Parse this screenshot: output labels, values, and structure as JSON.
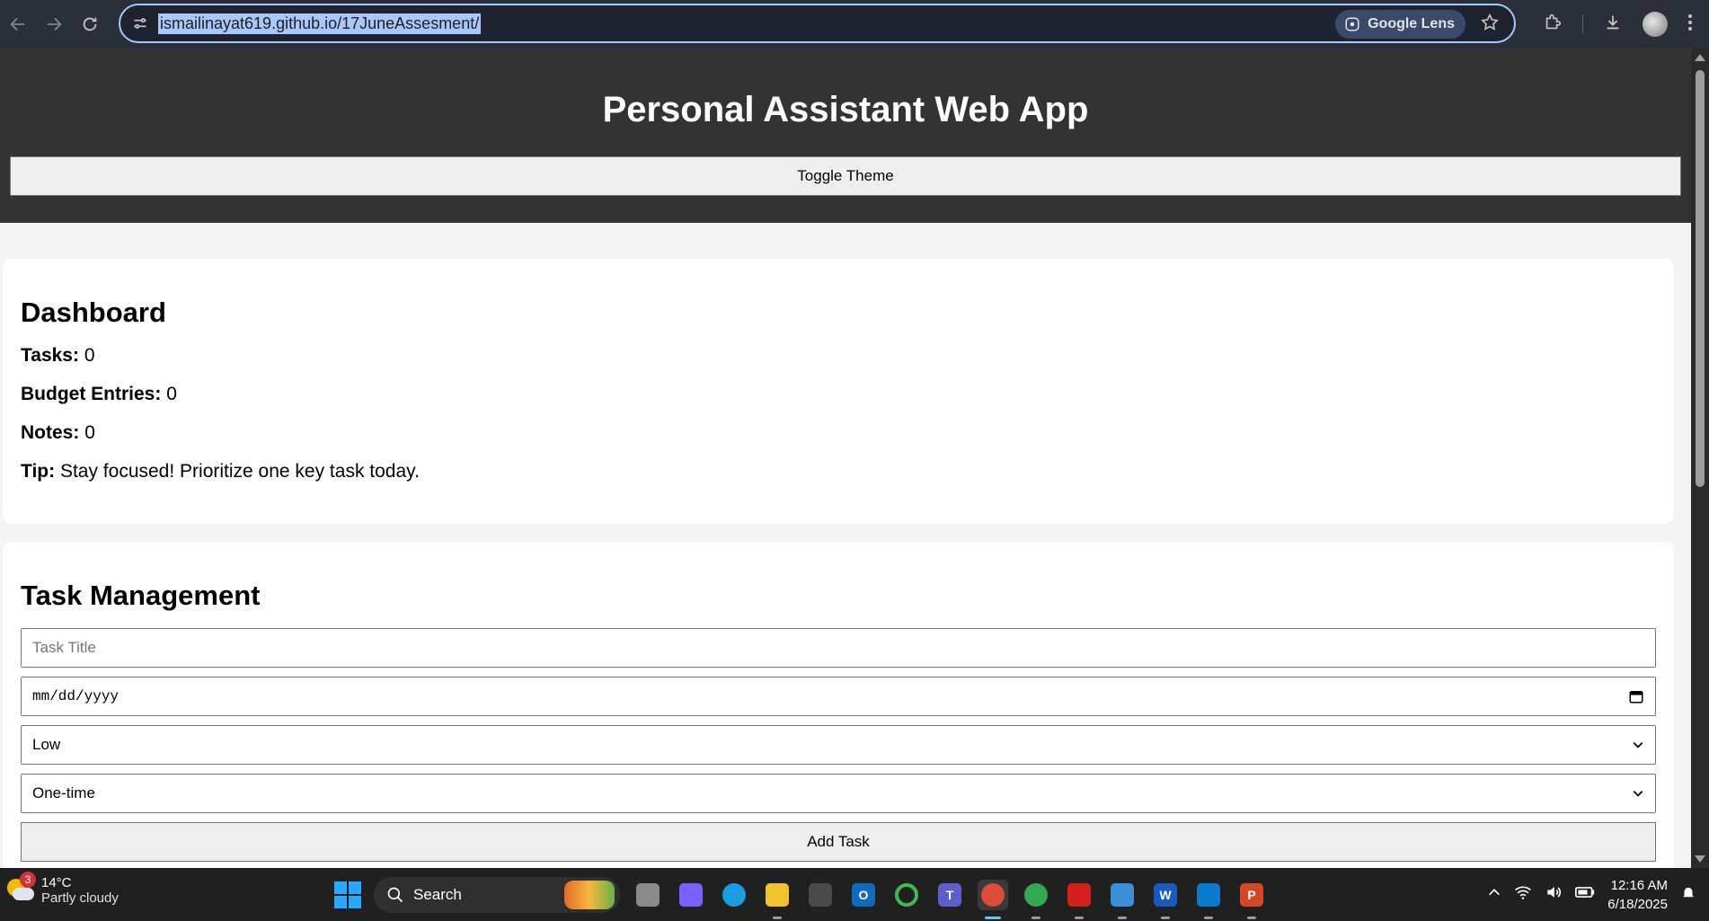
{
  "browser": {
    "url": "ismailinayat619.github.io/17JuneAssesment/",
    "lens_label": "Google Lens"
  },
  "header": {
    "title": "Personal Assistant Web App",
    "toggle_label": "Toggle Theme"
  },
  "dashboard": {
    "heading": "Dashboard",
    "tasks_label": "Tasks:",
    "tasks_value": "0",
    "budget_label": "Budget Entries:",
    "budget_value": "0",
    "notes_label": "Notes:",
    "notes_value": "0",
    "tip_label": "Tip:",
    "tip_value": "Stay focused! Prioritize one key task today."
  },
  "task_management": {
    "heading": "Task Management",
    "title_placeholder": "Task Title",
    "date_placeholder": "mm/dd/yyyy",
    "priority_selected": "Low",
    "recurrence_selected": "One-time",
    "add_label": "Add Task"
  },
  "taskbar": {
    "weather_temp": "14°C",
    "weather_desc": "Partly cloudy",
    "weather_badge": "3",
    "search_label": "Search",
    "time": "12:16 AM",
    "date": "6/18/2025",
    "apps": [
      {
        "name": "task-view",
        "color": "#8a8a8a",
        "letter": ""
      },
      {
        "name": "copilot",
        "color": "#7b61ff",
        "letter": ""
      },
      {
        "name": "edge",
        "color": "#1b9de2",
        "letter": ""
      },
      {
        "name": "file-explorer",
        "color": "#f2c12e",
        "letter": ""
      },
      {
        "name": "microsoft-store",
        "color": "#4a4a4a",
        "letter": ""
      },
      {
        "name": "outlook",
        "color": "#0f6cbd",
        "letter": "O"
      },
      {
        "name": "loader-app",
        "color": "#202020",
        "letter": ""
      },
      {
        "name": "teams",
        "color": "#5b5fc7",
        "letter": "T"
      },
      {
        "name": "chrome",
        "color": "#dd4b39",
        "letter": ""
      },
      {
        "name": "chrome-profile",
        "color": "#34a853",
        "letter": ""
      },
      {
        "name": "acrobat",
        "color": "#d4201b",
        "letter": ""
      },
      {
        "name": "notepad",
        "color": "#3b8fd6",
        "letter": ""
      },
      {
        "name": "word",
        "color": "#185abd",
        "letter": "W"
      },
      {
        "name": "vscode",
        "color": "#0a7acc",
        "letter": ""
      },
      {
        "name": "powerpoint",
        "color": "#d24726",
        "letter": "P"
      }
    ]
  }
}
